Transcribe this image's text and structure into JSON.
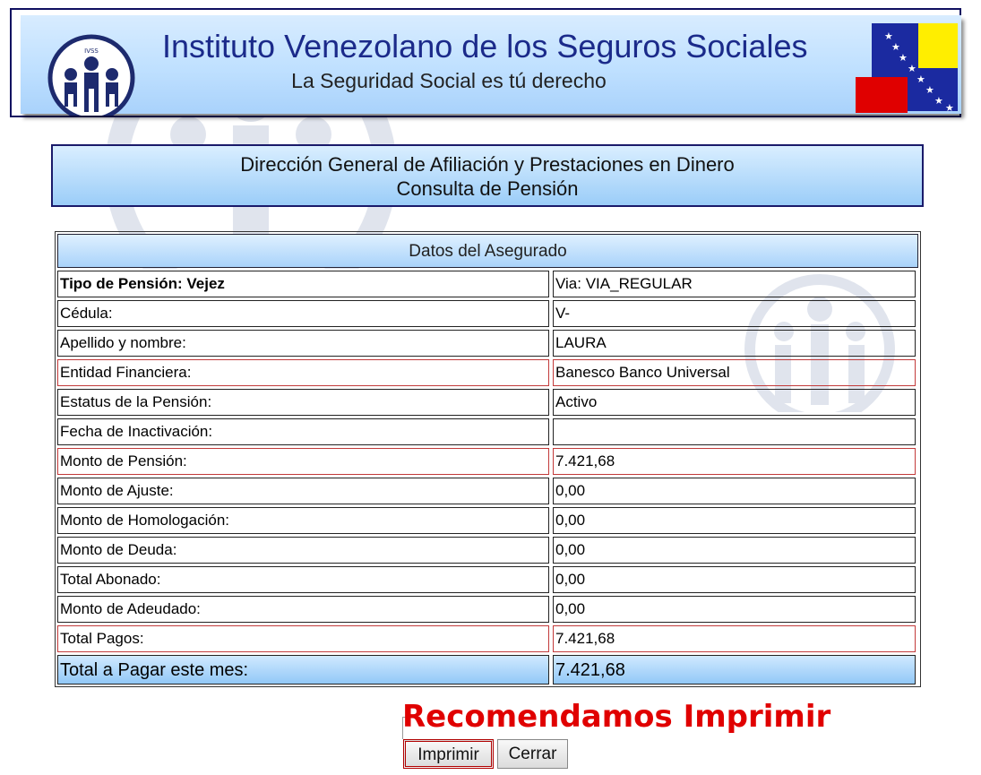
{
  "header": {
    "title": "Instituto Venezolano de los Seguros Sociales",
    "subtitle": "La Seguridad Social es tú derecho",
    "logo_text": "IVSS",
    "colors": {
      "header_bg": "#bfe0ff",
      "title": "#1b2a8a",
      "flag_yellow": "#ffee00",
      "flag_blue": "#1b2aa0",
      "flag_red": "#e00000"
    }
  },
  "section": {
    "line1": "Dirección General de Afiliación y Prestaciones en Dinero",
    "line2": "Consulta de Pensión"
  },
  "table": {
    "title": "Datos del Asegurado",
    "rows": [
      {
        "label": "Tipo de Pensión: Vejez",
        "value": "Via: VIA_REGULAR",
        "bold": true,
        "red": false
      },
      {
        "label": "Cédula:",
        "value": "V-",
        "red": false
      },
      {
        "label": "Apellido y nombre:",
        "value": "LAURA",
        "red": false
      },
      {
        "label": "Entidad Financiera:",
        "value": "Banesco Banco Universal",
        "red": true
      },
      {
        "label": "Estatus de la Pensión:",
        "value": "Activo",
        "red": false
      },
      {
        "label": "Fecha de Inactivación:",
        "value": "",
        "red": false
      },
      {
        "label": "Monto de Pensión:",
        "value": "7.421,68",
        "red": true
      },
      {
        "label": "Monto de Ajuste:",
        "value": "0,00",
        "red": false
      },
      {
        "label": "Monto de Homologación:",
        "value": "0,00",
        "red": false
      },
      {
        "label": "Monto de Deuda:",
        "value": "0,00",
        "red": false
      },
      {
        "label": "Total Abonado:",
        "value": "0,00",
        "red": false
      },
      {
        "label": "Monto de Adeudado:",
        "value": "0,00",
        "red": false
      },
      {
        "label": "Total Pagos:",
        "value": "7.421,68",
        "red": true
      }
    ],
    "total": {
      "label": "Total a Pagar este mes:",
      "value": "7.421,68"
    }
  },
  "recommend_text": "Recomendamos Imprimir",
  "buttons": {
    "print": "Imprimir",
    "close": "Cerrar"
  }
}
